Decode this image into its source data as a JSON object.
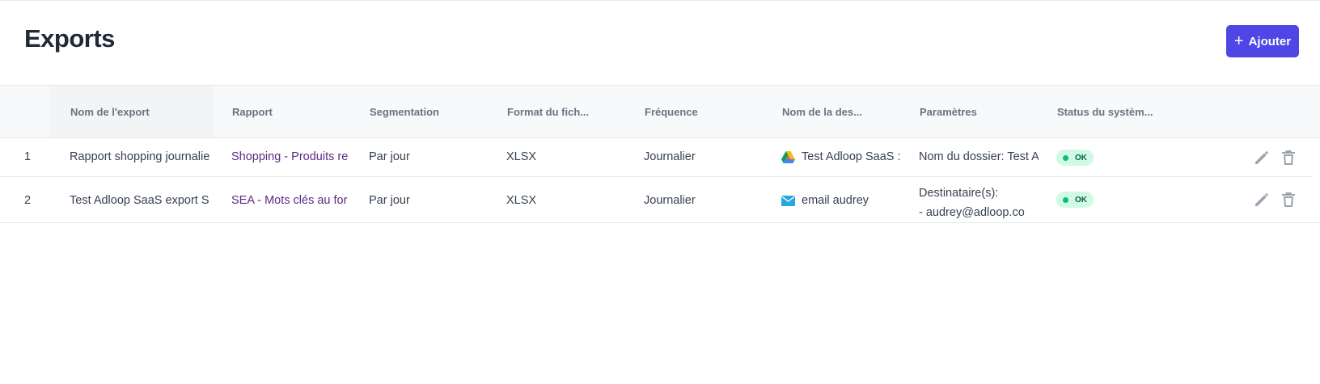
{
  "page": {
    "title": "Exports"
  },
  "toolbar": {
    "add_label": "Ajouter"
  },
  "table": {
    "headers": {
      "name": "Nom de l'export",
      "report": "Rapport",
      "segmentation": "Segmentation",
      "format": "Format du fich...",
      "frequency": "Fréquence",
      "destination": "Nom de la des...",
      "params": "Paramètres",
      "status": "Status du systèm..."
    },
    "rows": [
      {
        "index": "1",
        "name": "Rapport shopping journalie",
        "report": "Shopping - Produits re",
        "segmentation": "Par jour",
        "format": "XLSX",
        "frequency": "Journalier",
        "destination": "Test Adloop SaaS :",
        "destination_icon": "google-drive-icon",
        "params": "Nom du dossier: Test A",
        "status": "OK"
      },
      {
        "index": "2",
        "name": "Test Adloop SaaS export S",
        "report": "SEA - Mots clés au for",
        "segmentation": "Par jour",
        "format": "XLSX",
        "frequency": "Journalier",
        "destination": "email audrey",
        "destination_icon": "email-icon",
        "params_line1": "Destinataire(s):",
        "params_line2": "- audrey@adloop.co",
        "status": "OK"
      }
    ]
  },
  "colors": {
    "accent": "#4f46e5",
    "link": "#5b2a86",
    "ok_bg": "#d1fae5",
    "ok_dot": "#10b981"
  }
}
